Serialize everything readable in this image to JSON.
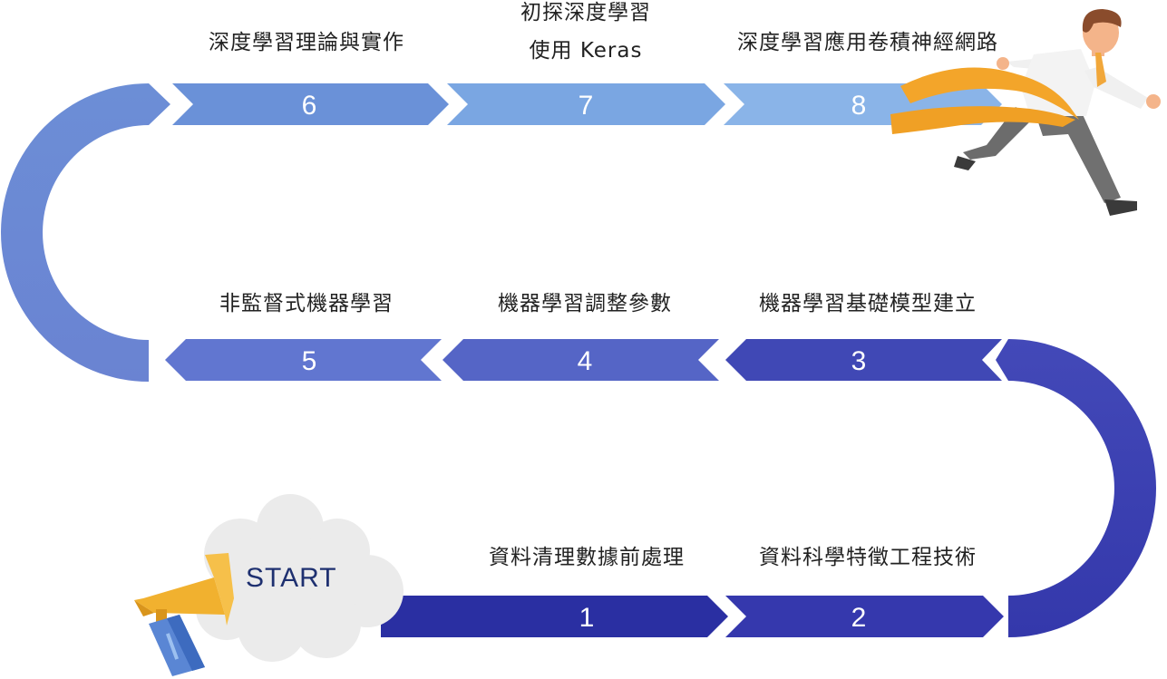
{
  "start_label": "START",
  "steps": [
    {
      "number": "1",
      "title": "資料清理數據前處理",
      "color": "#2a2fa2"
    },
    {
      "number": "2",
      "title": "資料科學特徵工程技術",
      "color": "#3538ad"
    },
    {
      "number": "3",
      "title": "機器學習基礎模型建立",
      "color": "#4048b5"
    },
    {
      "number": "4",
      "title": "機器學習調整參數",
      "color": "#5565c6"
    },
    {
      "number": "5",
      "title": "非監督式機器學習",
      "color": "#6176d0"
    },
    {
      "number": "6",
      "title": "深度學習理論與實作",
      "color": "#6a91d8"
    },
    {
      "number": "7",
      "title_line1": "初探深度學習",
      "title_line2": "使用 Keras",
      "color": "#7aa6e2"
    },
    {
      "number": "8",
      "title": "深度學習應用卷積神經網路",
      "color": "#8ab4e8"
    }
  ]
}
